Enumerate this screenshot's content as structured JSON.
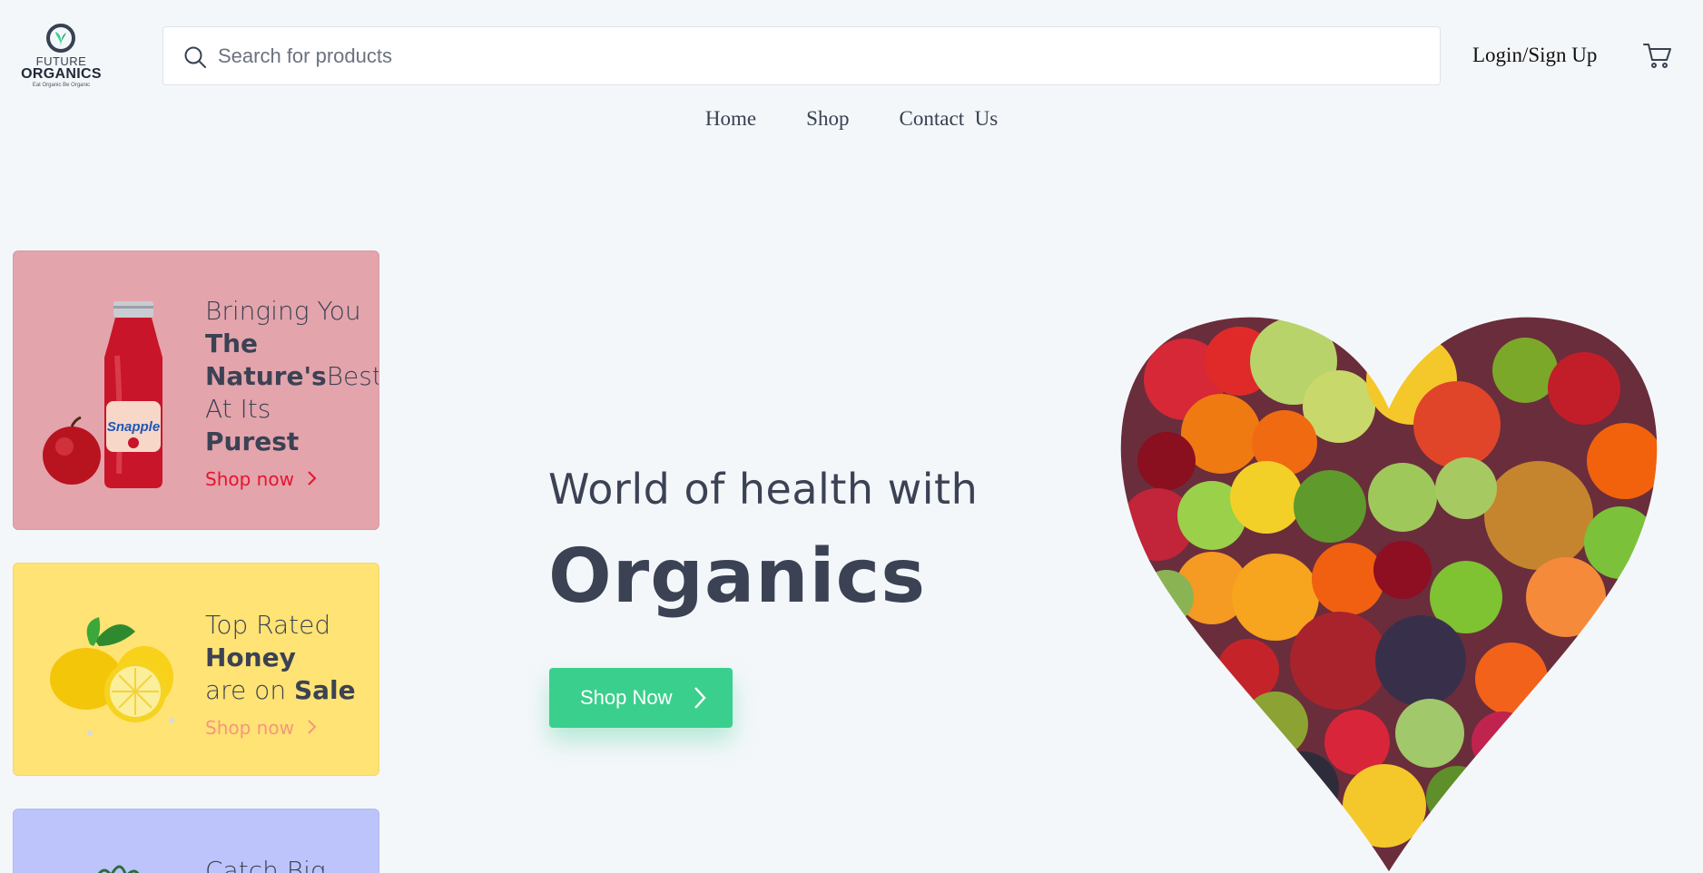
{
  "logo": {
    "line1": "FUTURE",
    "line2": "ORGANICS",
    "tagline": "Eat Organic Be Organic"
  },
  "search": {
    "placeholder": "Search for products",
    "value": ""
  },
  "header": {
    "login_label": "Login/Sign Up",
    "cart_icon": "cart-icon"
  },
  "nav": {
    "items": [
      "Home",
      "Shop",
      "Contact  Us"
    ]
  },
  "cards": [
    {
      "pre": "Bringing You",
      "b1": "The",
      "b2": "Nature's",
      "post": "Best",
      "line4": "At Its",
      "b3": "Purest",
      "shop": "Shop now",
      "bg": "#e3a4ac"
    },
    {
      "pre": "Top Rated",
      "b1": "Honey",
      "mid": "are on ",
      "b2": "Sale",
      "shop": "Shop now",
      "bg": "#ffe374"
    },
    {
      "pre": "Catch Big",
      "bg": "#bcc4fb"
    }
  ],
  "hero": {
    "subtitle": "World of health with",
    "title": "Organics",
    "button": "Shop Now",
    "accent": "#3bcf8e"
  }
}
